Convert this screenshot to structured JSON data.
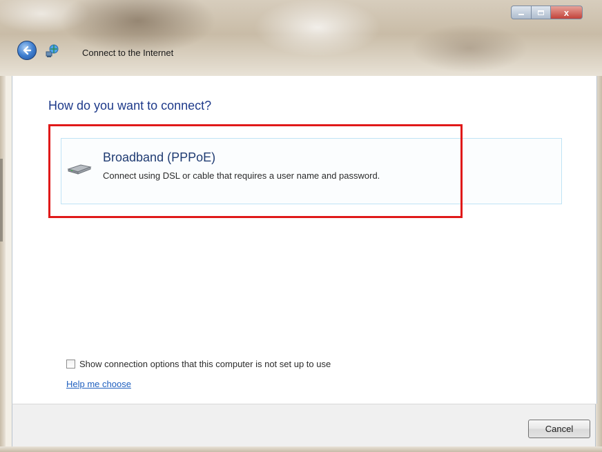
{
  "window": {
    "title": "Connect to the Internet",
    "controls": {
      "minimize_icon": "minimize-icon",
      "maximize_icon": "maximize-icon",
      "close_label": "x"
    }
  },
  "toolbar": {
    "back_icon": "back-arrow-icon",
    "app_icon": "network-globe-icon"
  },
  "main": {
    "heading": "How do you want to connect?",
    "options": [
      {
        "title": "Broadband (PPPoE)",
        "description": "Connect using DSL or cable that requires a user name and password.",
        "icon": "modem-icon"
      }
    ],
    "highlight_color": "#e01919",
    "show_options_checkbox": {
      "label": "Show connection options that this computer is not set up to use",
      "checked": false
    },
    "help_link": "Help me choose"
  },
  "footer": {
    "cancel_label": "Cancel"
  },
  "colors": {
    "heading": "#1e3a8a",
    "link": "#1e5fbf",
    "option_border": "#bfe3f5"
  }
}
